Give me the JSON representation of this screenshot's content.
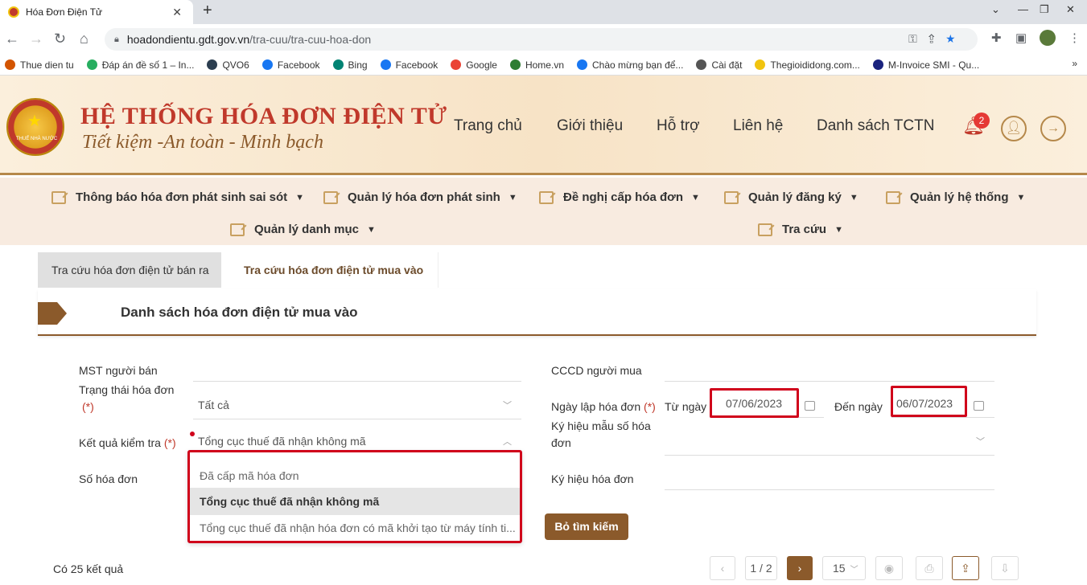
{
  "browser": {
    "tab_title": "Hóa Đơn Điện Tử",
    "url_host": "hoadondientu.gdt.gov.vn",
    "url_path": "/tra-cuu/tra-cuu-hoa-don",
    "bookmarks": [
      "Thue dien tu",
      "Đáp án đề số 1 – In...",
      "QVO6",
      "Facebook",
      "Bing",
      "Facebook",
      "Google",
      "Home.vn",
      "Chào mừng bạn để...",
      "Cài đặt",
      "Thegioididong.com...",
      "M-Invoice SMI - Qu..."
    ],
    "bookmark_colors": [
      "#d35400",
      "#27ae60",
      "#2c3e50",
      "#1877f2",
      "#008373",
      "#1877f2",
      "#ea4335",
      "#2e7d32",
      "#1877f2",
      "#555555",
      "#f1c40f",
      "#1a237e"
    ]
  },
  "header": {
    "title": "HỆ THỐNG HÓA ĐƠN ĐIỆN TỬ",
    "slogan": "Tiết kiệm -An toàn - Minh bạch",
    "emblem_text": "THUẾ NHÀ NƯỚC",
    "nav": [
      "Trang chủ",
      "Giới thiệu",
      "Hỗ trợ",
      "Liên hệ",
      "Danh sách TCTN"
    ],
    "notification_count": "2"
  },
  "menu": {
    "items": [
      "Thông báo hóa đơn phát sinh sai sót",
      "Quản lý hóa đơn phát sinh",
      "Đề nghị cấp hóa đơn",
      "Quản lý đăng ký",
      "Quản lý hệ thống",
      "Quản lý danh mục",
      "Tra cứu"
    ]
  },
  "tabs": {
    "sold": "Tra cứu hóa đơn điện tử bán ra",
    "bought": "Tra cứu hóa đơn điện tử mua vào"
  },
  "section": {
    "title": "Danh sách hóa đơn điện tử mua vào"
  },
  "form": {
    "mst_label": "MST người bán",
    "status_label": "Trạng thái hóa đơn",
    "required_mark": "(*)",
    "status_value": "Tất cả",
    "check_label": "Kết quả kiểm tra",
    "check_value": "Tổng cục thuế đã nhận không mã",
    "invoice_no_label": "Số hóa đơn",
    "cccd_label": "CCCD người mua",
    "date_label": "Ngày lập hóa đơn",
    "from_label": "Từ ngày",
    "from_value": "07/06/2023",
    "to_label": "Đến ngày",
    "to_value": "06/07/2023",
    "template_label_1": "Ký hiệu mẫu số hóa",
    "template_label_2": "đơn",
    "symbol_label": "Ký hiệu hóa đơn",
    "dropdown_options": [
      "Đã cấp mã hóa đơn",
      "Tổng cục thuế đã nhận không mã",
      "Tổng cục thuế đã nhận hóa đơn có mã khởi tạo từ máy tính ti..."
    ],
    "clear_button": "Bỏ tìm kiếm"
  },
  "results": {
    "count_text": "Có 25 kết quả",
    "page": "1 / 2",
    "page_size": "15"
  }
}
